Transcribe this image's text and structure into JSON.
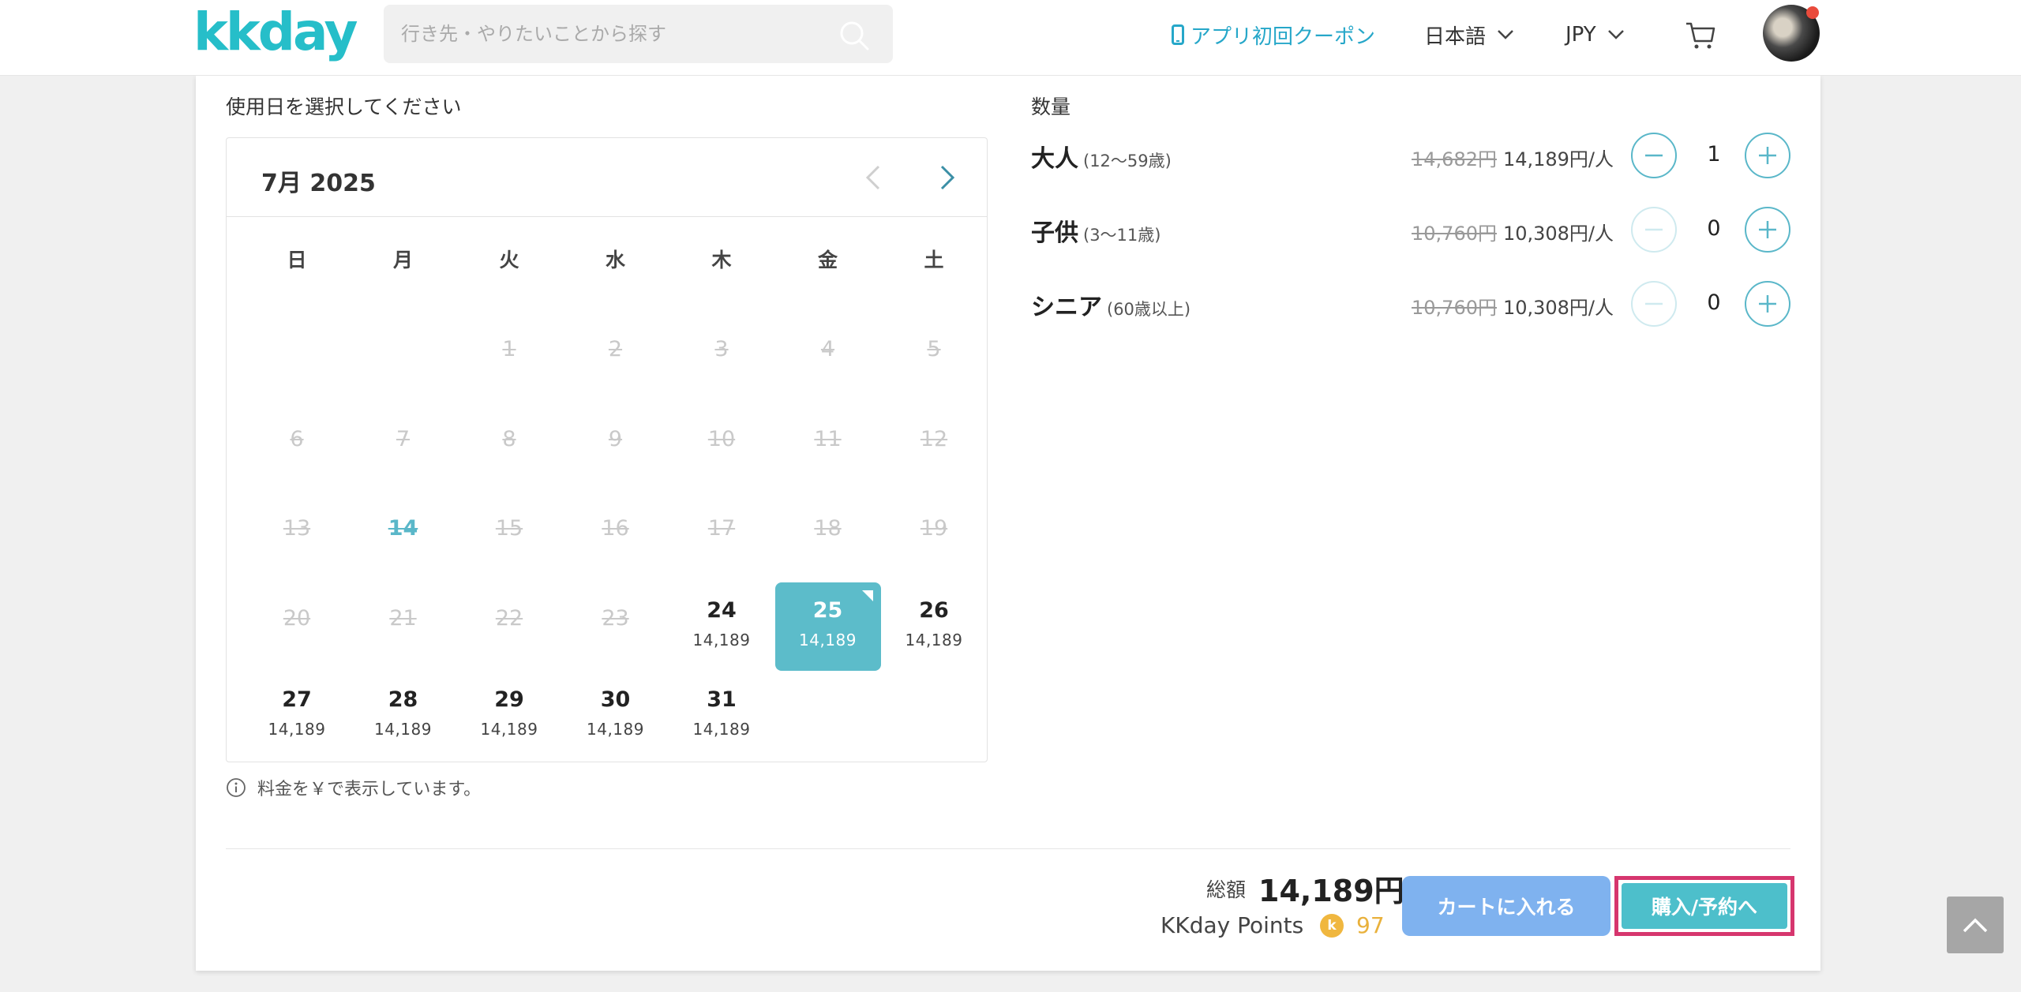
{
  "header": {
    "logo": "kkday",
    "search_placeholder": "行き先・やりたいことから探す",
    "coupon_link": "アプリ初回クーポン",
    "language": "日本語",
    "currency": "JPY"
  },
  "date_section": {
    "label": "使用日を選択してください",
    "month": "7月 2025",
    "weekdays": [
      "日",
      "月",
      "火",
      "水",
      "木",
      "金",
      "土"
    ],
    "days": [
      {
        "d": "1",
        "state": "disabled"
      },
      {
        "d": "2",
        "state": "disabled"
      },
      {
        "d": "3",
        "state": "disabled"
      },
      {
        "d": "4",
        "state": "disabled"
      },
      {
        "d": "5",
        "state": "disabled"
      },
      {
        "d": "6",
        "state": "disabled"
      },
      {
        "d": "7",
        "state": "disabled"
      },
      {
        "d": "8",
        "state": "disabled"
      },
      {
        "d": "9",
        "state": "disabled"
      },
      {
        "d": "10",
        "state": "disabled"
      },
      {
        "d": "11",
        "state": "disabled"
      },
      {
        "d": "12",
        "state": "disabled"
      },
      {
        "d": "13",
        "state": "disabled"
      },
      {
        "d": "14",
        "state": "today"
      },
      {
        "d": "15",
        "state": "disabled"
      },
      {
        "d": "16",
        "state": "disabled"
      },
      {
        "d": "17",
        "state": "disabled"
      },
      {
        "d": "18",
        "state": "disabled"
      },
      {
        "d": "19",
        "state": "disabled"
      },
      {
        "d": "20",
        "state": "disabled"
      },
      {
        "d": "21",
        "state": "disabled"
      },
      {
        "d": "22",
        "state": "disabled"
      },
      {
        "d": "23",
        "state": "disabled"
      },
      {
        "d": "24",
        "state": "available",
        "price": "14,189"
      },
      {
        "d": "25",
        "state": "selected",
        "price": "14,189"
      },
      {
        "d": "26",
        "state": "available",
        "price": "14,189"
      },
      {
        "d": "27",
        "state": "available",
        "price": "14,189"
      },
      {
        "d": "28",
        "state": "available",
        "price": "14,189"
      },
      {
        "d": "29",
        "state": "available",
        "price": "14,189"
      },
      {
        "d": "30",
        "state": "available",
        "price": "14,189"
      },
      {
        "d": "31",
        "state": "available",
        "price": "14,189"
      }
    ],
    "note": "料金を￥で表示しています。"
  },
  "quantity_section": {
    "label": "数量",
    "rows": [
      {
        "name": "大人",
        "age": "(12〜59歳)",
        "old_price": "14,682円",
        "price": "14,189円/人",
        "count": "1",
        "minus_enabled": true
      },
      {
        "name": "子供",
        "age": "(3〜11歳)",
        "old_price": "10,760円",
        "price": "10,308円/人",
        "count": "0",
        "minus_enabled": false
      },
      {
        "name": "シニア",
        "age": "(60歳以上)",
        "old_price": "10,760円",
        "price": "10,308円/人",
        "count": "0",
        "minus_enabled": false
      }
    ]
  },
  "footer": {
    "total_label": "総額",
    "total_value": "14,189円",
    "points_label": "KKday Points",
    "points_coin": "k",
    "points_value": "97",
    "cart_button": "カートに入れる",
    "buy_button": "購入/予約へ"
  },
  "colors": {
    "brand": "#26bec9",
    "selected_day": "#5cbcca",
    "cart_button": "#7fb2ef",
    "buy_button": "#4dbfcb",
    "highlight_border": "#d6366e"
  }
}
